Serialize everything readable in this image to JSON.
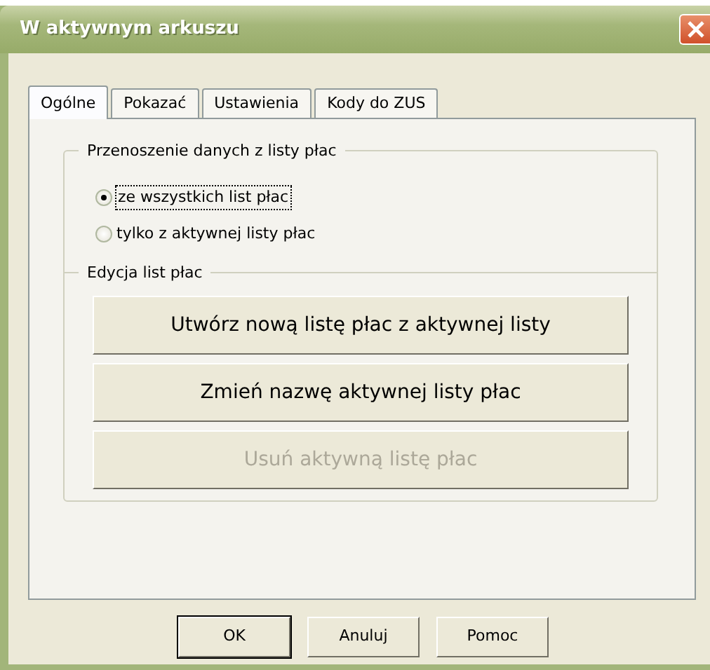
{
  "window": {
    "title": "W aktywnym arkuszu"
  },
  "tabs": [
    {
      "label": "Ogólne",
      "selected": true
    },
    {
      "label": "Pokazać",
      "selected": false
    },
    {
      "label": "Ustawienia",
      "selected": false
    },
    {
      "label": "Kody do ZUS",
      "selected": false
    }
  ],
  "transfer_group": {
    "title": "Przenoszenie danych z listy płac",
    "options": [
      {
        "label": "ze wszystkich list płac",
        "selected": true,
        "focused": true
      },
      {
        "label": "tylko z aktywnej listy płac",
        "selected": false,
        "focused": false
      }
    ]
  },
  "edit_group": {
    "title": "Edycja list płac",
    "buttons": [
      {
        "label": "Utwórz nową listę płac z aktywnej listy",
        "disabled": false
      },
      {
        "label": "Zmień nazwę aktywnej listy płac",
        "disabled": false
      },
      {
        "label": "Usuń aktywną listę płac",
        "disabled": true
      }
    ]
  },
  "footer_buttons": [
    {
      "label": "OK",
      "default": true
    },
    {
      "label": "Anuluj",
      "default": false
    },
    {
      "label": "Pomoc",
      "default": false
    }
  ]
}
